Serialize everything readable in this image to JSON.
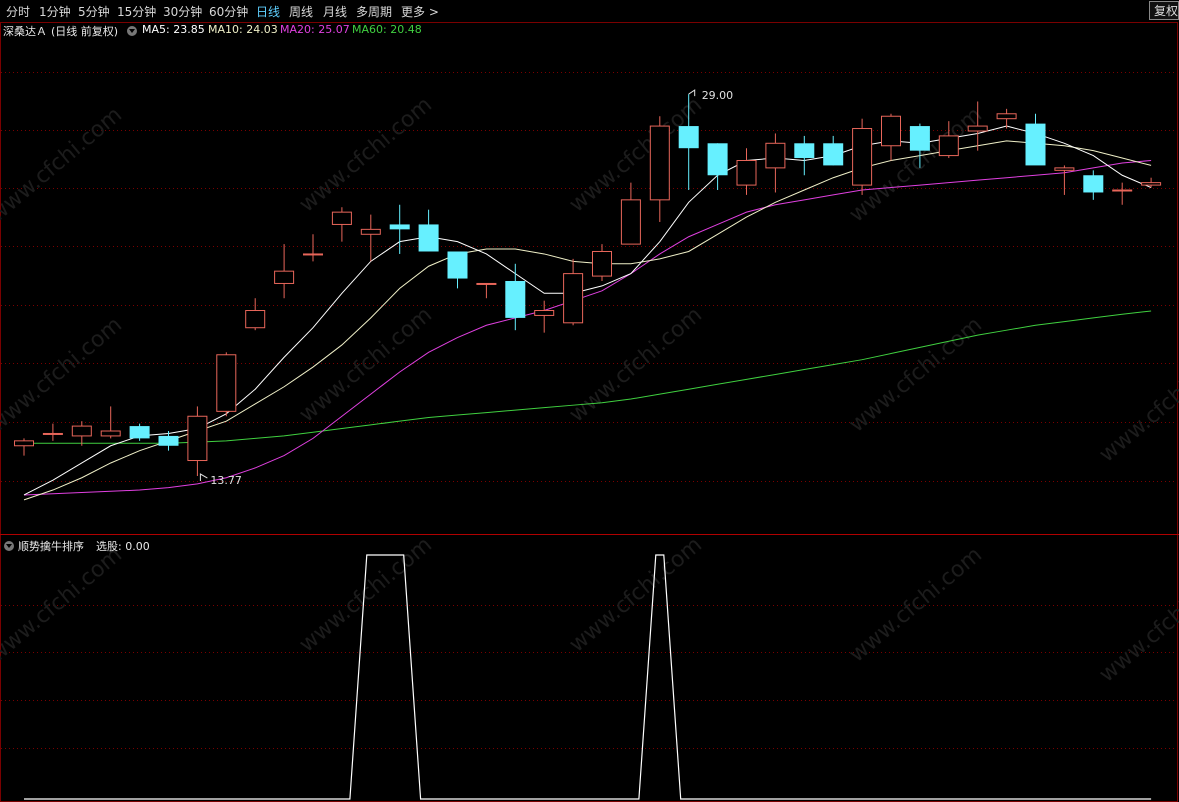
{
  "toolbar": {
    "tabs": [
      {
        "label": "分时",
        "active": false
      },
      {
        "label": "1分钟",
        "active": false
      },
      {
        "label": "5分钟",
        "active": false
      },
      {
        "label": "15分钟",
        "active": false
      },
      {
        "label": "30分钟",
        "active": false
      },
      {
        "label": "60分钟",
        "active": false
      },
      {
        "label": "日线",
        "active": true
      },
      {
        "label": "周线",
        "active": false
      },
      {
        "label": "月线",
        "active": false
      },
      {
        "label": "多周期",
        "active": false
      },
      {
        "label": "更多",
        "active": false
      }
    ],
    "restore_label": "复权"
  },
  "info": {
    "stock_name": "深桑达Ａ",
    "period_label": "(日线 前复权)",
    "ma5": "MA5: 23.85",
    "ma10": "MA10: 24.03",
    "ma20": "MA20: 25.07",
    "ma60": "MA60: 20.48"
  },
  "colors": {
    "up": "#e8665a",
    "down": "#66f0ff",
    "ma5": "#ffffff",
    "ma10": "#f0f0c8",
    "ma20": "#e040e0",
    "ma60": "#40d040",
    "active_tab": "#5fd0ff",
    "indicator_line": "#ffffff"
  },
  "annotations": {
    "high": "29.00",
    "low": "13.77"
  },
  "chart_data": {
    "type": "candlestick",
    "price_range": [
      11.9,
      31.5
    ],
    "candles": [
      {
        "o": 15.0,
        "h": 15.3,
        "l": 14.6,
        "c": 15.2
      },
      {
        "o": 15.5,
        "h": 15.9,
        "l": 15.2,
        "c": 15.5
      },
      {
        "o": 15.4,
        "h": 16.0,
        "l": 15.0,
        "c": 15.8
      },
      {
        "o": 15.4,
        "h": 16.6,
        "l": 15.3,
        "c": 15.6
      },
      {
        "o": 15.8,
        "h": 15.9,
        "l": 15.2,
        "c": 15.3
      },
      {
        "o": 15.4,
        "h": 15.6,
        "l": 14.8,
        "c": 15.0
      },
      {
        "o": 14.4,
        "h": 16.6,
        "l": 13.77,
        "c": 16.2
      },
      {
        "o": 16.4,
        "h": 18.8,
        "l": 16.2,
        "c": 18.7
      },
      {
        "o": 19.8,
        "h": 21.0,
        "l": 19.7,
        "c": 20.5
      },
      {
        "o": 21.6,
        "h": 23.2,
        "l": 21.0,
        "c": 22.1
      },
      {
        "o": 22.8,
        "h": 23.6,
        "l": 22.5,
        "c": 22.8
      },
      {
        "o": 24.0,
        "h": 24.7,
        "l": 23.3,
        "c": 24.5
      },
      {
        "o": 23.6,
        "h": 24.4,
        "l": 22.5,
        "c": 23.8
      },
      {
        "o": 24.0,
        "h": 24.8,
        "l": 22.8,
        "c": 23.8
      },
      {
        "o": 24.0,
        "h": 24.6,
        "l": 22.9,
        "c": 22.9
      },
      {
        "o": 22.9,
        "h": 22.9,
        "l": 21.4,
        "c": 21.8
      },
      {
        "o": 21.6,
        "h": 21.6,
        "l": 21.0,
        "c": 21.6
      },
      {
        "o": 21.7,
        "h": 22.4,
        "l": 19.7,
        "c": 20.2
      },
      {
        "o": 20.3,
        "h": 20.9,
        "l": 19.6,
        "c": 20.5
      },
      {
        "o": 20.0,
        "h": 22.6,
        "l": 19.9,
        "c": 22.0
      },
      {
        "o": 21.9,
        "h": 23.2,
        "l": 21.7,
        "c": 22.9
      },
      {
        "o": 23.2,
        "h": 25.7,
        "l": 23.2,
        "c": 25.0
      },
      {
        "o": 25.0,
        "h": 28.4,
        "l": 24.1,
        "c": 28.0
      },
      {
        "o": 28.0,
        "h": 29.3,
        "l": 25.4,
        "c": 27.1
      },
      {
        "o": 27.3,
        "h": 27.3,
        "l": 25.4,
        "c": 26.0
      },
      {
        "o": 25.6,
        "h": 27.1,
        "l": 25.2,
        "c": 26.6
      },
      {
        "o": 26.3,
        "h": 27.7,
        "l": 25.3,
        "c": 27.3
      },
      {
        "o": 27.3,
        "h": 27.6,
        "l": 26.0,
        "c": 26.7
      },
      {
        "o": 27.3,
        "h": 27.6,
        "l": 26.4,
        "c": 26.4
      },
      {
        "o": 25.6,
        "h": 28.3,
        "l": 25.2,
        "c": 27.9
      },
      {
        "o": 27.2,
        "h": 28.5,
        "l": 26.6,
        "c": 28.4
      },
      {
        "o": 28.0,
        "h": 28.1,
        "l": 26.3,
        "c": 27.0
      },
      {
        "o": 26.8,
        "h": 28.2,
        "l": 26.7,
        "c": 27.6
      },
      {
        "o": 27.8,
        "h": 29.0,
        "l": 27.0,
        "c": 28.0
      },
      {
        "o": 28.3,
        "h": 28.7,
        "l": 27.9,
        "c": 28.5
      },
      {
        "o": 28.1,
        "h": 28.5,
        "l": 26.5,
        "c": 26.4
      },
      {
        "o": 26.2,
        "h": 26.4,
        "l": 25.2,
        "c": 26.3
      },
      {
        "o": 26.0,
        "h": 26.2,
        "l": 25.0,
        "c": 25.3
      },
      {
        "o": 25.4,
        "h": 25.7,
        "l": 24.8,
        "c": 25.4
      },
      {
        "o": 25.6,
        "h": 25.9,
        "l": 25.5,
        "c": 25.7
      }
    ],
    "ma5": [
      13.0,
      13.6,
      14.3,
      15.0,
      15.4,
      15.5,
      15.7,
      16.3,
      17.3,
      18.6,
      19.8,
      21.2,
      22.5,
      23.3,
      23.5,
      23.3,
      22.8,
      22.0,
      21.2,
      21.2,
      21.5,
      22.0,
      23.3,
      24.9,
      26.0,
      26.6,
      26.7,
      26.6,
      26.8,
      27.2,
      27.4,
      27.3,
      27.5,
      27.7,
      28.0,
      27.7,
      27.3,
      26.8,
      26.0,
      25.5
    ],
    "ma10": [
      12.8,
      13.2,
      13.7,
      14.3,
      14.8,
      15.2,
      15.6,
      16.0,
      16.7,
      17.4,
      18.2,
      19.1,
      20.2,
      21.4,
      22.3,
      22.8,
      23.0,
      23.0,
      22.8,
      22.5,
      22.4,
      22.4,
      22.6,
      22.9,
      23.6,
      24.3,
      24.9,
      25.4,
      25.9,
      26.3,
      26.6,
      26.8,
      27.0,
      27.2,
      27.4,
      27.3,
      27.2,
      27.0,
      26.7,
      26.4
    ],
    "ma20": [
      13.0,
      13.05,
      13.1,
      13.15,
      13.2,
      13.3,
      13.45,
      13.7,
      14.1,
      14.6,
      15.3,
      16.2,
      17.1,
      18.0,
      18.8,
      19.4,
      19.9,
      20.2,
      20.5,
      20.9,
      21.3,
      22.0,
      22.8,
      23.5,
      24.0,
      24.5,
      24.8,
      25.0,
      25.2,
      25.4,
      25.5,
      25.6,
      25.7,
      25.8,
      25.9,
      26.0,
      26.1,
      26.3,
      26.5,
      26.6
    ],
    "ma60": [
      15.1,
      15.1,
      15.1,
      15.1,
      15.1,
      15.1,
      15.15,
      15.2,
      15.3,
      15.4,
      15.55,
      15.7,
      15.85,
      16.0,
      16.15,
      16.25,
      16.35,
      16.45,
      16.55,
      16.65,
      16.75,
      16.9,
      17.1,
      17.3,
      17.5,
      17.7,
      17.9,
      18.1,
      18.3,
      18.5,
      18.75,
      19.0,
      19.25,
      19.5,
      19.7,
      19.9,
      20.05,
      20.2,
      20.35,
      20.48
    ]
  },
  "indicator": {
    "name": "顺势擒牛排序",
    "value_label": "选股: 0.00",
    "signal": [
      0,
      0,
      0,
      0,
      0,
      0,
      0,
      0,
      0,
      0,
      0,
      0,
      1,
      1,
      0,
      0,
      0,
      0,
      0,
      0,
      0,
      0,
      1,
      0,
      0,
      0,
      0,
      0,
      0,
      0,
      0,
      0,
      0,
      0,
      0,
      0,
      0,
      0,
      0,
      0
    ]
  },
  "watermark": "www.cfchi.com"
}
